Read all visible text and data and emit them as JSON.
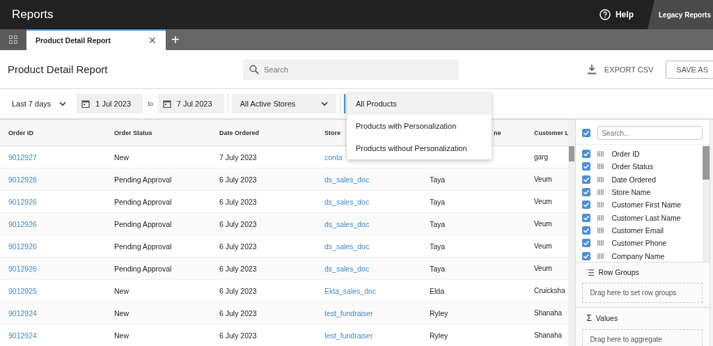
{
  "app_bar": {
    "title": "Reports",
    "help": "Help",
    "legacy": "Legacy Reports"
  },
  "tabs": [
    {
      "label": "Product Detail Report",
      "selected": true,
      "close": "×"
    }
  ],
  "add_tab": "+",
  "header": {
    "title": "Product Detail Report",
    "search_placeholder": "Search",
    "export": "EXPORT CSV",
    "save": "SAVE AS"
  },
  "filters": {
    "range": "Last 7 days",
    "from": "1 Jul 2023",
    "to_label": "to",
    "to": "7 Jul 2023",
    "stores": "All Active Stores"
  },
  "product_menu": [
    {
      "label": "All Products",
      "selected": true
    },
    {
      "label": "Products with Personalization",
      "selected": false
    },
    {
      "label": "Products without Personalization",
      "selected": false
    }
  ],
  "table": {
    "columns": [
      "Order ID",
      "Order Status",
      "Date Ordered",
      "Store",
      "ne",
      "Customer L"
    ],
    "rows": [
      {
        "order_id": "9012927",
        "status": "New",
        "date": "7 July 2023",
        "store": "conta",
        "last": "garg"
      },
      {
        "order_id": "9012926",
        "status": "Pending Approval",
        "date": "6 July 2023",
        "store": "ds_sales_doc",
        "first": "Taya",
        "last": "Veum"
      },
      {
        "order_id": "9012926",
        "status": "Pending Approval",
        "date": "6 July 2023",
        "store": "ds_sales_doc",
        "first": "Taya",
        "last": "Veum"
      },
      {
        "order_id": "9012926",
        "status": "Pending Approval",
        "date": "6 July 2023",
        "store": "ds_sales_doc",
        "first": "Taya",
        "last": "Veum"
      },
      {
        "order_id": "9012926",
        "status": "Pending Approval",
        "date": "6 July 2023",
        "store": "ds_sales_doc",
        "first": "Taya",
        "last": "Veum"
      },
      {
        "order_id": "9012926",
        "status": "Pending Approval",
        "date": "6 July 2023",
        "store": "ds_sales_doc",
        "first": "Taya",
        "last": "Veum"
      },
      {
        "order_id": "9012925",
        "status": "New",
        "date": "6 July 2023",
        "store": "Ekta_sales_doc",
        "first": "Elda",
        "last": "Cruicksha"
      },
      {
        "order_id": "9012924",
        "status": "New",
        "date": "6 July 2023",
        "store": "test_fundraiser",
        "first": "Ryley",
        "last": "Shanaha"
      },
      {
        "order_id": "9012924",
        "status": "New",
        "date": "6 July 2023",
        "store": "test_fundraiser",
        "first": "Ryley",
        "last": "Shanaha"
      }
    ]
  },
  "column_panel": {
    "select_all_checked": true,
    "search_placeholder": "Search...",
    "columns": [
      {
        "label": "Order ID",
        "checked": true
      },
      {
        "label": "Order Status",
        "checked": true
      },
      {
        "label": "Date Ordered",
        "checked": true
      },
      {
        "label": "Store Name",
        "checked": true
      },
      {
        "label": "Customer First Name",
        "checked": true
      },
      {
        "label": "Customer Last Name",
        "checked": true
      },
      {
        "label": "Customer Email",
        "checked": true
      },
      {
        "label": "Customer Phone",
        "checked": true
      },
      {
        "label": "Company Name",
        "checked": true
      }
    ],
    "row_groups": {
      "title": "Row Groups",
      "hint": "Drag here to set row groups"
    },
    "values": {
      "symbol": "Σ",
      "title": "Values",
      "hint": "Drag here to aggregate"
    }
  }
}
